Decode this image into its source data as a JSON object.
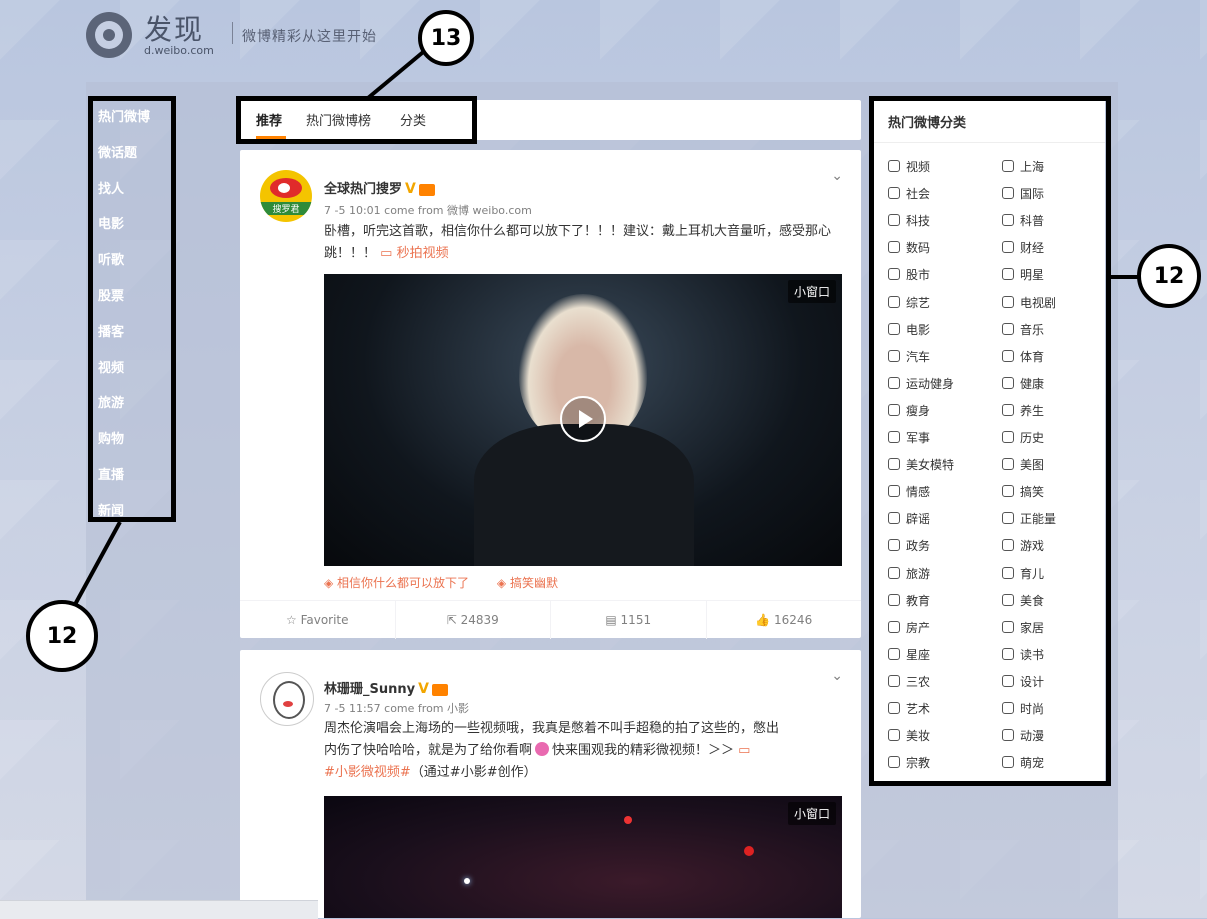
{
  "header": {
    "title": "发现",
    "domain": "d.weibo.com",
    "slogan": "微博精彩从这里开始"
  },
  "left_nav": [
    "热门微博",
    "微话题",
    "找人",
    "电影",
    "听歌",
    "股票",
    "播客",
    "视频",
    "旅游",
    "购物",
    "直播",
    "新闻"
  ],
  "tabs": [
    "推荐",
    "热门微博榜",
    "分类"
  ],
  "annotations": {
    "label_13": "13",
    "label_12_left": "12",
    "label_12_right": "12"
  },
  "posts": [
    {
      "author": "全球热门搜罗",
      "verified": "V",
      "meta": "7 -5 10:01 come from 微博 weibo.com",
      "text": "卧槽，听完这首歌，相信你什么都可以放下了！！！建议：戴上耳机大音量听，感受那心跳！！！",
      "link": "秒拍视频",
      "mini_window": "小窗口",
      "tags": [
        "相信你什么都可以放下了",
        "搞笑幽默"
      ],
      "actions": {
        "favorite": "Favorite",
        "repost": "24839",
        "comment": "1151",
        "like": "16246"
      },
      "avatar_text": "搜罗君"
    },
    {
      "author": "林珊珊_Sunny",
      "verified": "V",
      "meta": "7 -5 11:57 come from 小影",
      "text_line1": "周杰伦演唱会上海场的一些视频哦，我真是憋着不叫手超稳的拍了这些的，憋出",
      "text_line2": "内伤了快哈哈哈，就是为了给你看啊",
      "text_line2b": "快来围观我的精彩微视频！＞＞",
      "link": "#小影微视频#",
      "text_line3b": "（通过#小影#创作）",
      "mini_window": "小窗口"
    }
  ],
  "categories": {
    "title": "热门微博分类",
    "items": [
      [
        "视频",
        "上海"
      ],
      [
        "社会",
        "国际"
      ],
      [
        "科技",
        "科普"
      ],
      [
        "数码",
        "财经"
      ],
      [
        "股市",
        "明星"
      ],
      [
        "综艺",
        "电视剧"
      ],
      [
        "电影",
        "音乐"
      ],
      [
        "汽车",
        "体育"
      ],
      [
        "运动健身",
        "健康"
      ],
      [
        "瘦身",
        "养生"
      ],
      [
        "军事",
        "历史"
      ],
      [
        "美女模特",
        "美图"
      ],
      [
        "情感",
        "搞笑"
      ],
      [
        "辟谣",
        "正能量"
      ],
      [
        "政务",
        "游戏"
      ],
      [
        "旅游",
        "育儿"
      ],
      [
        "教育",
        "美食"
      ],
      [
        "房产",
        "家居"
      ],
      [
        "星座",
        "读书"
      ],
      [
        "三农",
        "设计"
      ],
      [
        "艺术",
        "时尚"
      ],
      [
        "美妆",
        "动漫"
      ],
      [
        "宗教",
        "萌宠"
      ]
    ]
  },
  "colors": {
    "accent": "#ff8200",
    "link": "#eb7350",
    "panel_bg": "#c5cee2"
  }
}
